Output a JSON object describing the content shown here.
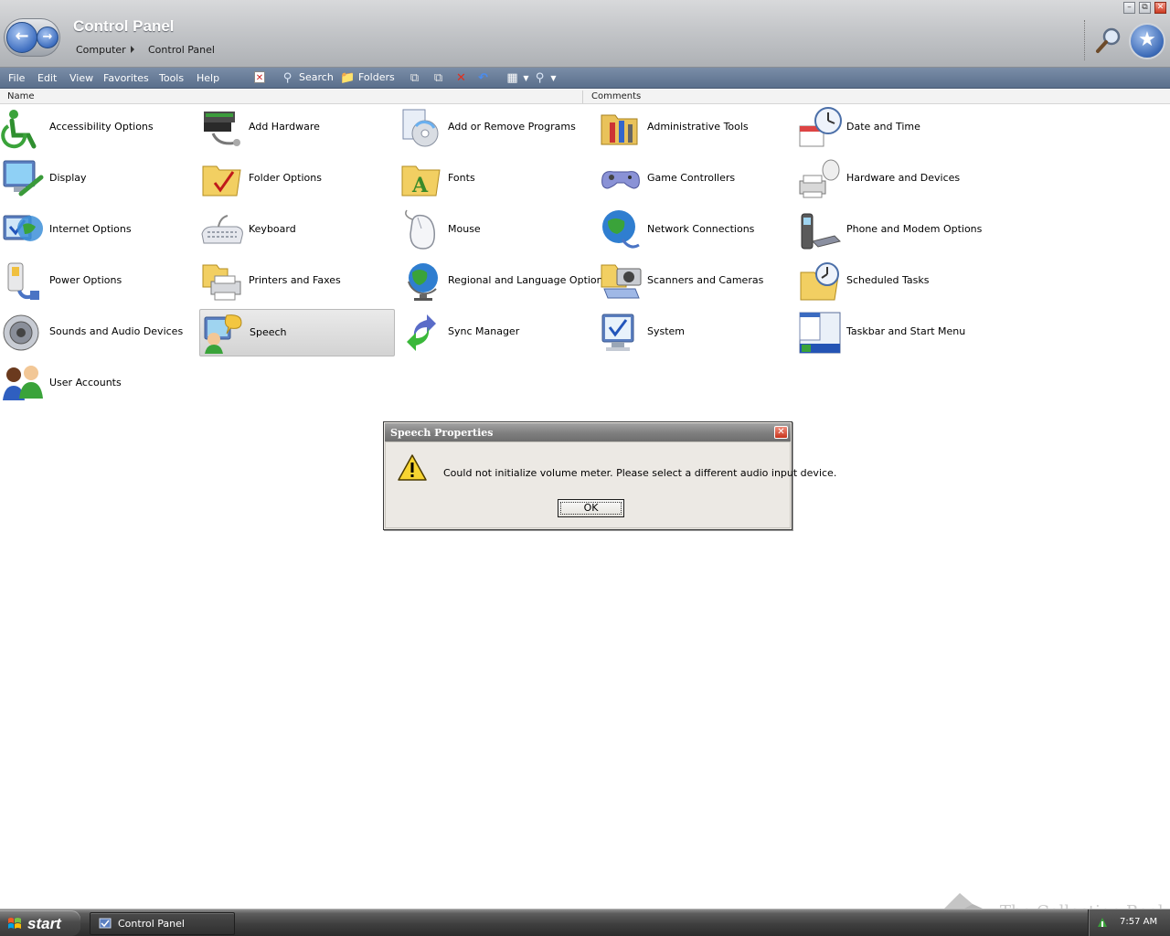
{
  "window": {
    "title": "Control Panel",
    "breadcrumb": [
      "Computer",
      "Control Panel"
    ]
  },
  "menubar": {
    "items": [
      "File",
      "Edit",
      "View",
      "Favorites",
      "Tools",
      "Help"
    ],
    "toolbar": {
      "search_label": "Search",
      "folders_label": "Folders"
    }
  },
  "columns": {
    "name": "Name",
    "comments": "Comments"
  },
  "items": [
    {
      "label": "Accessibility Options",
      "icon": "accessibility-icon"
    },
    {
      "label": "Add Hardware",
      "icon": "add-hardware-icon"
    },
    {
      "label": "Add or Remove Programs",
      "icon": "add-remove-programs-icon"
    },
    {
      "label": "Administrative Tools",
      "icon": "administrative-tools-icon"
    },
    {
      "label": "Date and Time",
      "icon": "date-time-icon"
    },
    {
      "label": "Display",
      "icon": "display-icon"
    },
    {
      "label": "Folder Options",
      "icon": "folder-options-icon"
    },
    {
      "label": "Fonts",
      "icon": "fonts-icon"
    },
    {
      "label": "Game Controllers",
      "icon": "game-controller-icon"
    },
    {
      "label": "Hardware and Devices",
      "icon": "hardware-devices-icon"
    },
    {
      "label": "Internet Options",
      "icon": "internet-options-icon"
    },
    {
      "label": "Keyboard",
      "icon": "keyboard-icon"
    },
    {
      "label": "Mouse",
      "icon": "mouse-icon"
    },
    {
      "label": "Network Connections",
      "icon": "network-icon"
    },
    {
      "label": "Phone and Modem Options",
      "icon": "phone-modem-icon"
    },
    {
      "label": "Power Options",
      "icon": "power-icon"
    },
    {
      "label": "Printers and Faxes",
      "icon": "printer-icon"
    },
    {
      "label": "Regional and Language Options",
      "icon": "globe-icon"
    },
    {
      "label": "Scanners and Cameras",
      "icon": "scanner-camera-icon"
    },
    {
      "label": "Scheduled Tasks",
      "icon": "scheduled-tasks-icon"
    },
    {
      "label": "Sounds and Audio Devices",
      "icon": "speaker-icon"
    },
    {
      "label": "Speech",
      "icon": "speech-icon",
      "selected": true
    },
    {
      "label": "Sync Manager",
      "icon": "sync-icon"
    },
    {
      "label": "System",
      "icon": "system-icon"
    },
    {
      "label": "Taskbar and Start Menu",
      "icon": "taskbar-icon"
    },
    {
      "label": "User Accounts",
      "icon": "user-accounts-icon"
    }
  ],
  "dialog": {
    "title": "Speech Properties",
    "message": "Could not initialize volume meter.  Please select a different audio input device.",
    "ok_label": "OK",
    "icon": "warning-icon"
  },
  "taskbar": {
    "start_label": "start",
    "task_label": "Control Panel",
    "clock": "7:57 AM"
  },
  "watermark": "The Collection Book",
  "colors": {
    "menubar": "#6a7e9a",
    "header": "#c4c6c9",
    "taskbar": "#3f3f3f",
    "selection": "#d9d9d9"
  }
}
